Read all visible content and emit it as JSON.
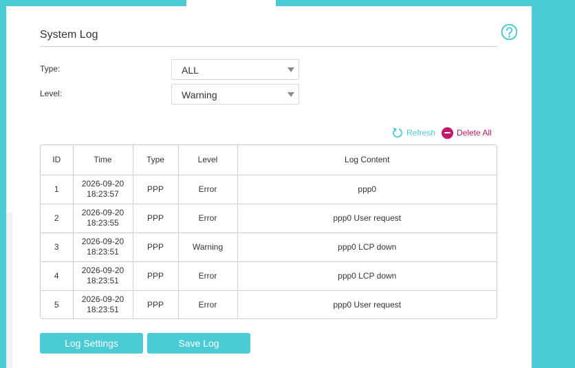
{
  "header": {
    "title": "System Log"
  },
  "filters": {
    "type": {
      "label": "Type:",
      "value": "ALL"
    },
    "level": {
      "label": "Level:",
      "value": "Warning"
    }
  },
  "actions": {
    "refresh_label": "Refresh",
    "delete_all_label": "Delete All"
  },
  "table": {
    "columns": [
      "ID",
      "Time",
      "Type",
      "Level",
      "Log Content"
    ],
    "rows": [
      {
        "id": "1",
        "time": "2026-09-20 18:23:57",
        "type": "PPP",
        "level": "Error",
        "content": "ppp0"
      },
      {
        "id": "2",
        "time": "2026-09-20 18:23:55",
        "type": "PPP",
        "level": "Error",
        "content": "ppp0 User request"
      },
      {
        "id": "3",
        "time": "2026-09-20 18:23:51",
        "type": "PPP",
        "level": "Warning",
        "content": "ppp0 LCP down"
      },
      {
        "id": "4",
        "time": "2026-09-20 18:23:51",
        "type": "PPP",
        "level": "Error",
        "content": "ppp0 LCP down"
      },
      {
        "id": "5",
        "time": "2026-09-20 18:23:51",
        "type": "PPP",
        "level": "Error",
        "content": "ppp0 User request"
      }
    ]
  },
  "buttons": {
    "log_settings": "Log Settings",
    "save_log": "Save Log"
  },
  "colors": {
    "accent": "#4acbd6",
    "danger": "#c2186b",
    "text": "#333333",
    "border": "#cfcfcf"
  },
  "icons": {
    "help": "help-circle-icon",
    "refresh": "refresh-icon",
    "delete": "minus-circle-icon",
    "dropdown": "chevron-down-icon"
  }
}
